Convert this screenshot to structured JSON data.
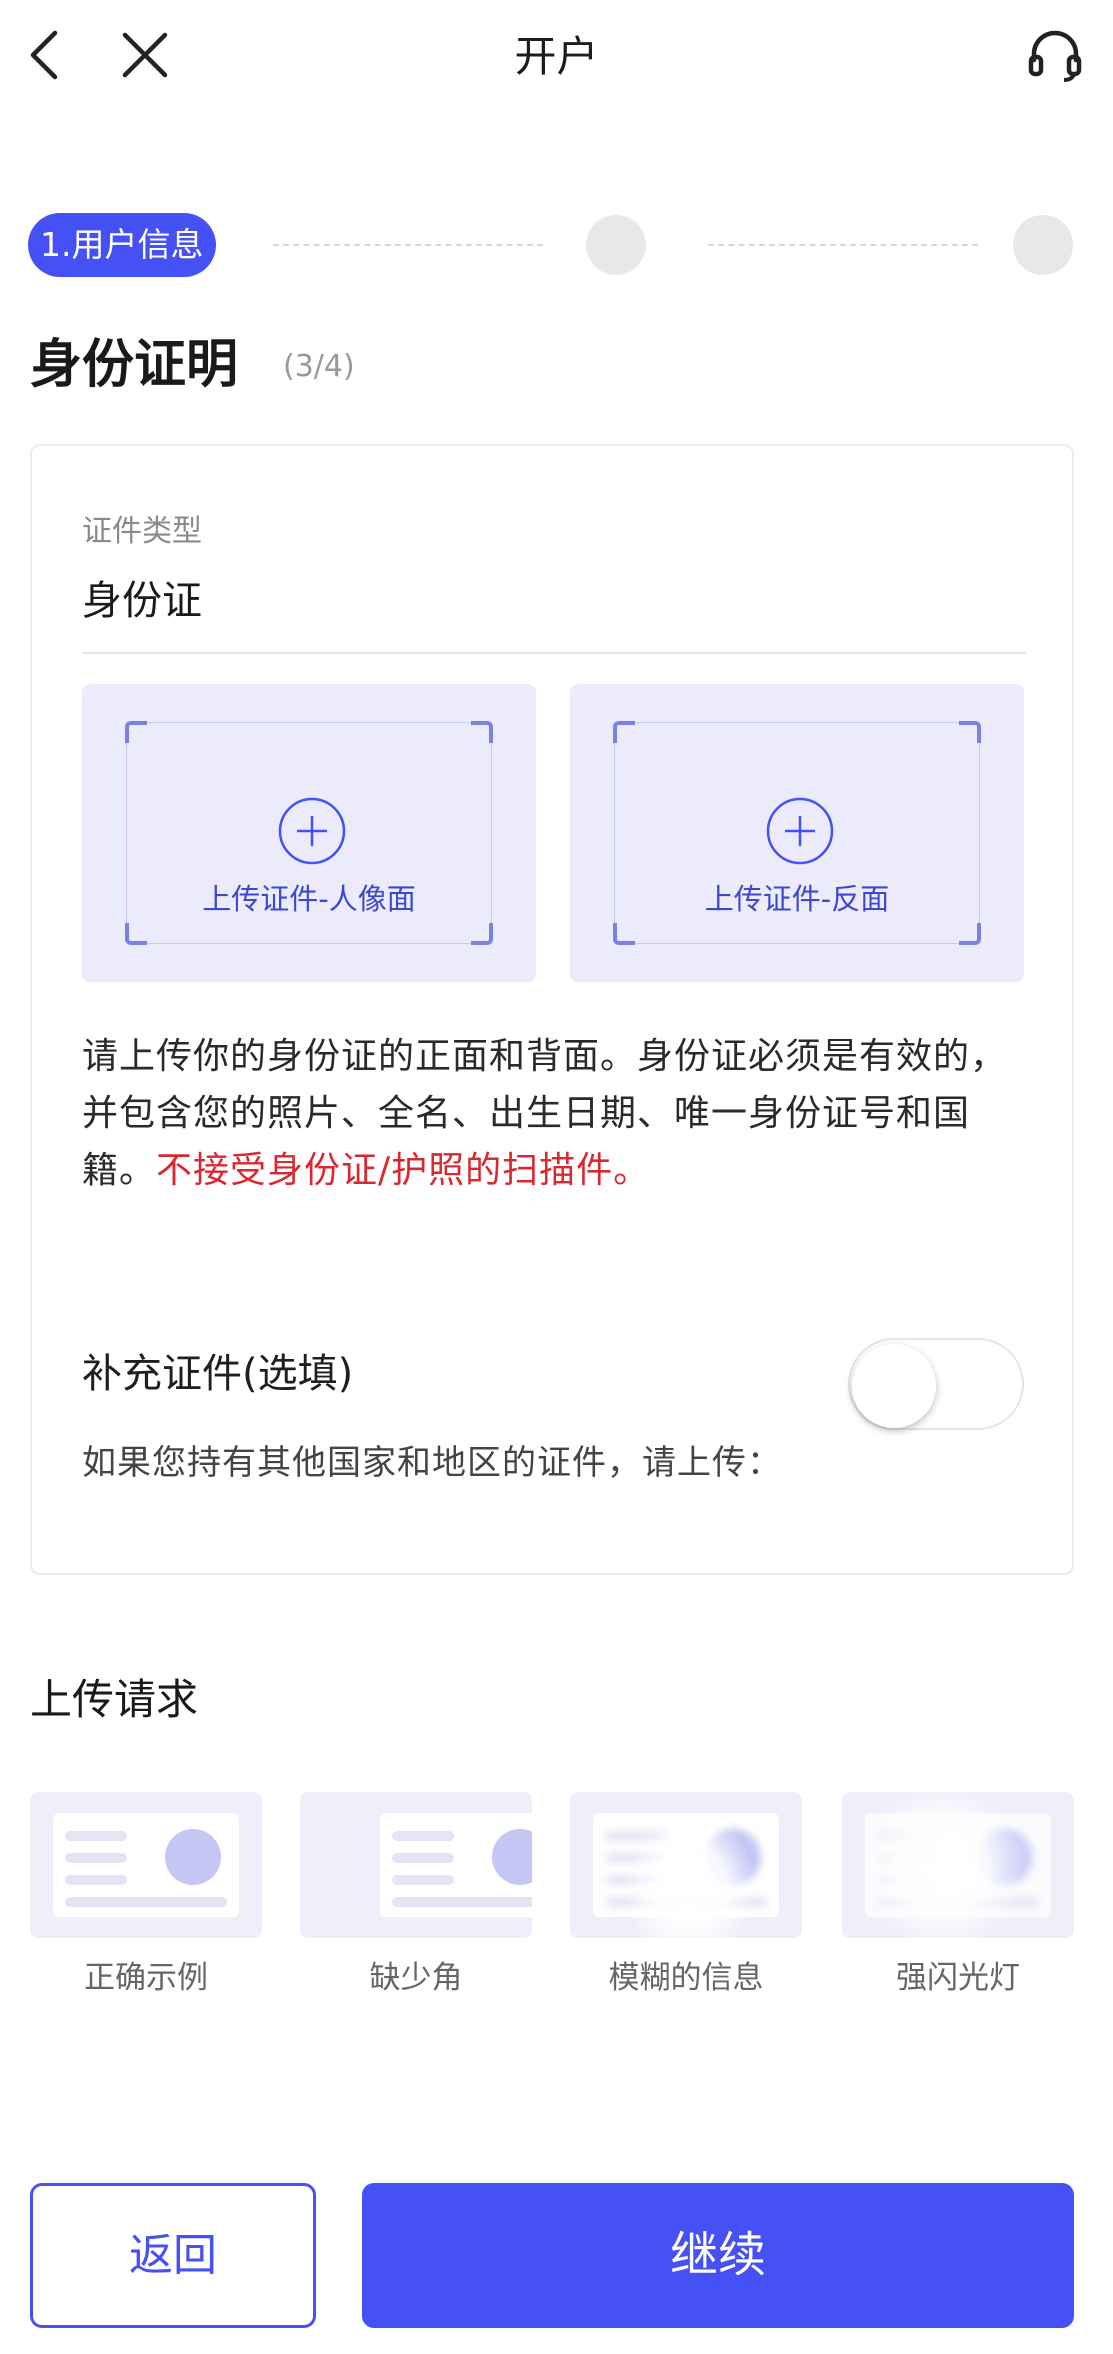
{
  "header": {
    "title": "开户",
    "back_icon": "chevron-left-icon",
    "close_icon": "close-icon",
    "support_icon": "headset-icon"
  },
  "stepper": {
    "active_label": "1.用户信息",
    "total_steps": 3,
    "current_step": 1
  },
  "section": {
    "title": "身份证明",
    "count": "(3/4)"
  },
  "document": {
    "type_label": "证件类型",
    "type_value": "身份证",
    "upload_front_label": "上传证件-人像面",
    "upload_back_label": "上传证件-反面",
    "description": "请上传你的身份证的正面和背面。身份证必须是有效的，并包含您的照片、全名、出生日期、唯一身份证号和国籍。",
    "warning": "不接受身份证/护照的扫描件。"
  },
  "supplement": {
    "label": "补充证件(选填)",
    "enabled": false,
    "description": "如果您持有其他国家和地区的证件，请上传："
  },
  "requirements": {
    "title": "上传请求",
    "examples": [
      {
        "label": "正确示例"
      },
      {
        "label": "缺少角"
      },
      {
        "label": "模糊的信息"
      },
      {
        "label": "强闪光灯"
      }
    ]
  },
  "buttons": {
    "back": "返回",
    "continue": "继续"
  },
  "colors": {
    "accent": "#4651f5",
    "warning": "#d9282f",
    "upload_bg": "#ebebfc"
  }
}
